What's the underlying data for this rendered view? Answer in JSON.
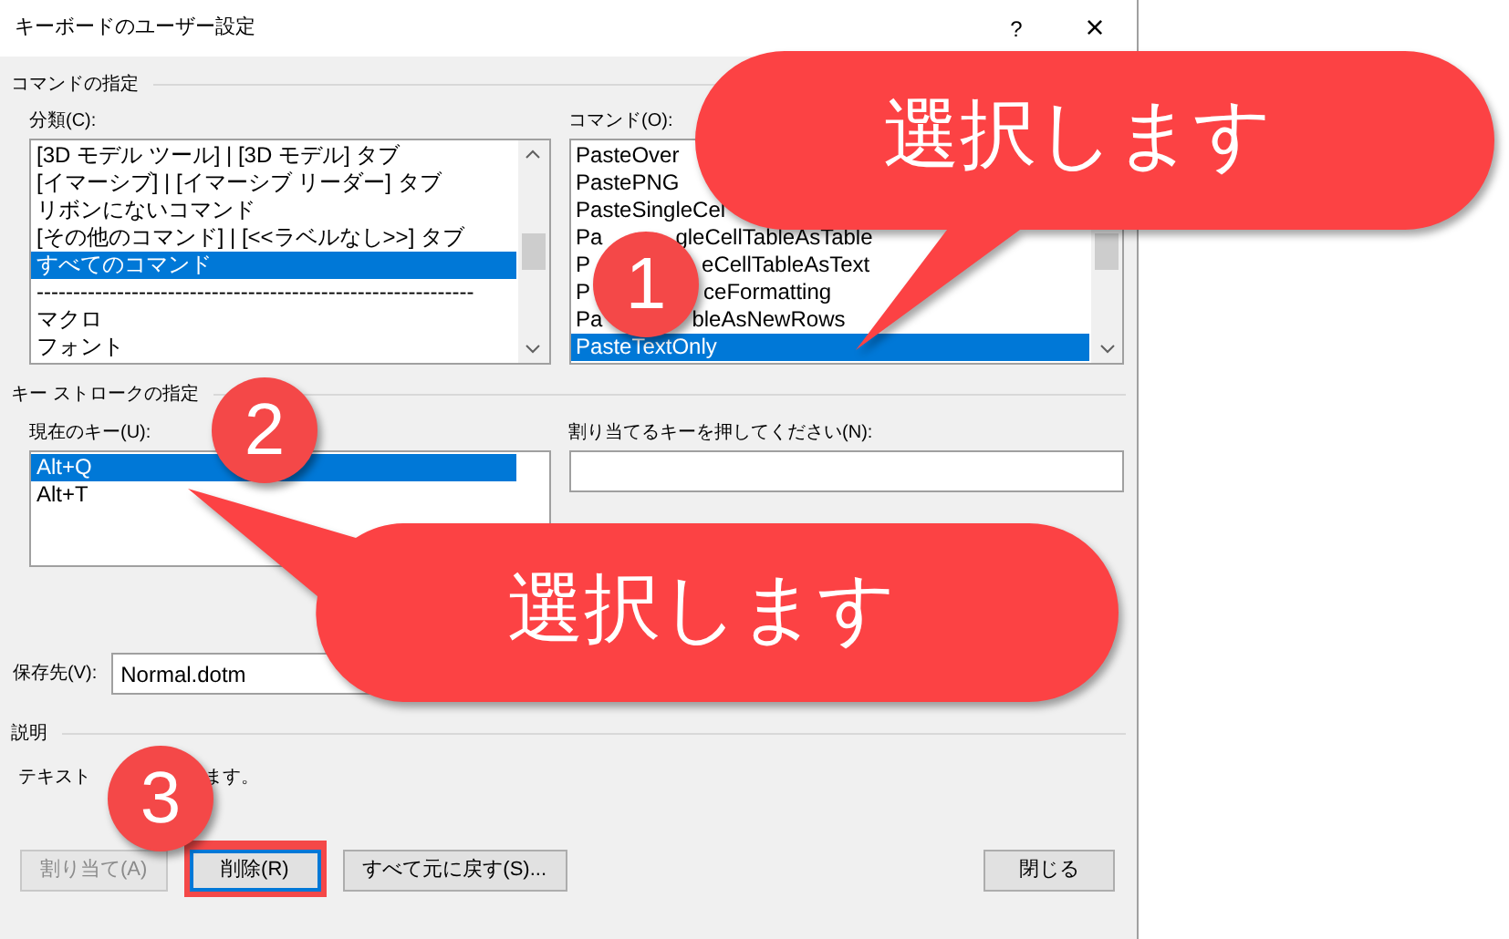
{
  "window": {
    "title": "キーボードのユーザー設定",
    "help": "?",
    "close": "×"
  },
  "command_section": {
    "title": "コマンドの指定",
    "categories": {
      "label": "分類(C):",
      "items": [
        {
          "parts": [
            "[3D モデル ツール] | [3D モデル] タブ"
          ],
          "selected": false
        },
        {
          "parts": [
            "[イマーシブ] | [イマーシブ リーダー] タブ"
          ],
          "selected": false
        },
        {
          "parts": [
            "リボンにないコマンド"
          ],
          "selected": false
        },
        {
          "parts": [
            "[その他のコマンド] | [<<ラベルなし>>] タブ"
          ],
          "selected": false
        },
        {
          "parts": [
            "すべてのコマンド"
          ],
          "selected": true
        },
        {
          "parts": [
            "------------------------------------------------------------"
          ],
          "selected": false
        },
        {
          "parts": [
            "マクロ"
          ],
          "selected": false
        },
        {
          "parts": [
            "フォント"
          ],
          "selected": false
        }
      ]
    },
    "commands": {
      "label": "コマンド(O):",
      "items": [
        {
          "parts": [
            "PasteOver"
          ],
          "selected": false
        },
        {
          "parts": [
            "PastePNG"
          ],
          "selected": false
        },
        {
          "parts": [
            "PasteSingleCel"
          ],
          "selected": false
        },
        {
          "parts": [
            "Pa",
            "gleCellTableAsTable"
          ],
          "selected": false
        },
        {
          "parts": [
            "P",
            "eCellTableAsText"
          ],
          "selected": false
        },
        {
          "parts": [
            "P",
            "ceFormatting"
          ],
          "selected": false
        },
        {
          "parts": [
            "Pa",
            "bleAsNewRows"
          ],
          "selected": false
        },
        {
          "parts": [
            "PasteTextOnly"
          ],
          "selected": true
        }
      ]
    }
  },
  "keystroke_section": {
    "title": "キー ストロークの指定",
    "current_keys": {
      "label": "現在のキー(U):",
      "items": [
        {
          "parts": [
            "Alt+Q"
          ],
          "selected": true
        },
        {
          "parts": [
            "Alt+T"
          ],
          "selected": false
        }
      ]
    },
    "new_key": {
      "label": "割り当てるキーを押してください(N):"
    }
  },
  "save_in": {
    "label": "保存先(V):",
    "value": "Normal.dotm"
  },
  "description": {
    "title": "説明",
    "parts": [
      "テキスト",
      "ます。"
    ]
  },
  "buttons": [
    {
      "label": "割り当て(A)",
      "disabled": true,
      "highlighted": false
    },
    {
      "label": "削除(R)",
      "disabled": false,
      "highlighted": true
    },
    {
      "label": "すべて元に戻す(S)...",
      "disabled": false,
      "highlighted": false
    },
    {
      "label": "閉じる",
      "disabled": false,
      "highlighted": false
    }
  ],
  "callouts": [
    {
      "text": "選択します"
    },
    {
      "text": "選択します"
    }
  ],
  "steps": [
    {
      "text": "1"
    },
    {
      "text": "2"
    },
    {
      "text": "3"
    }
  ]
}
